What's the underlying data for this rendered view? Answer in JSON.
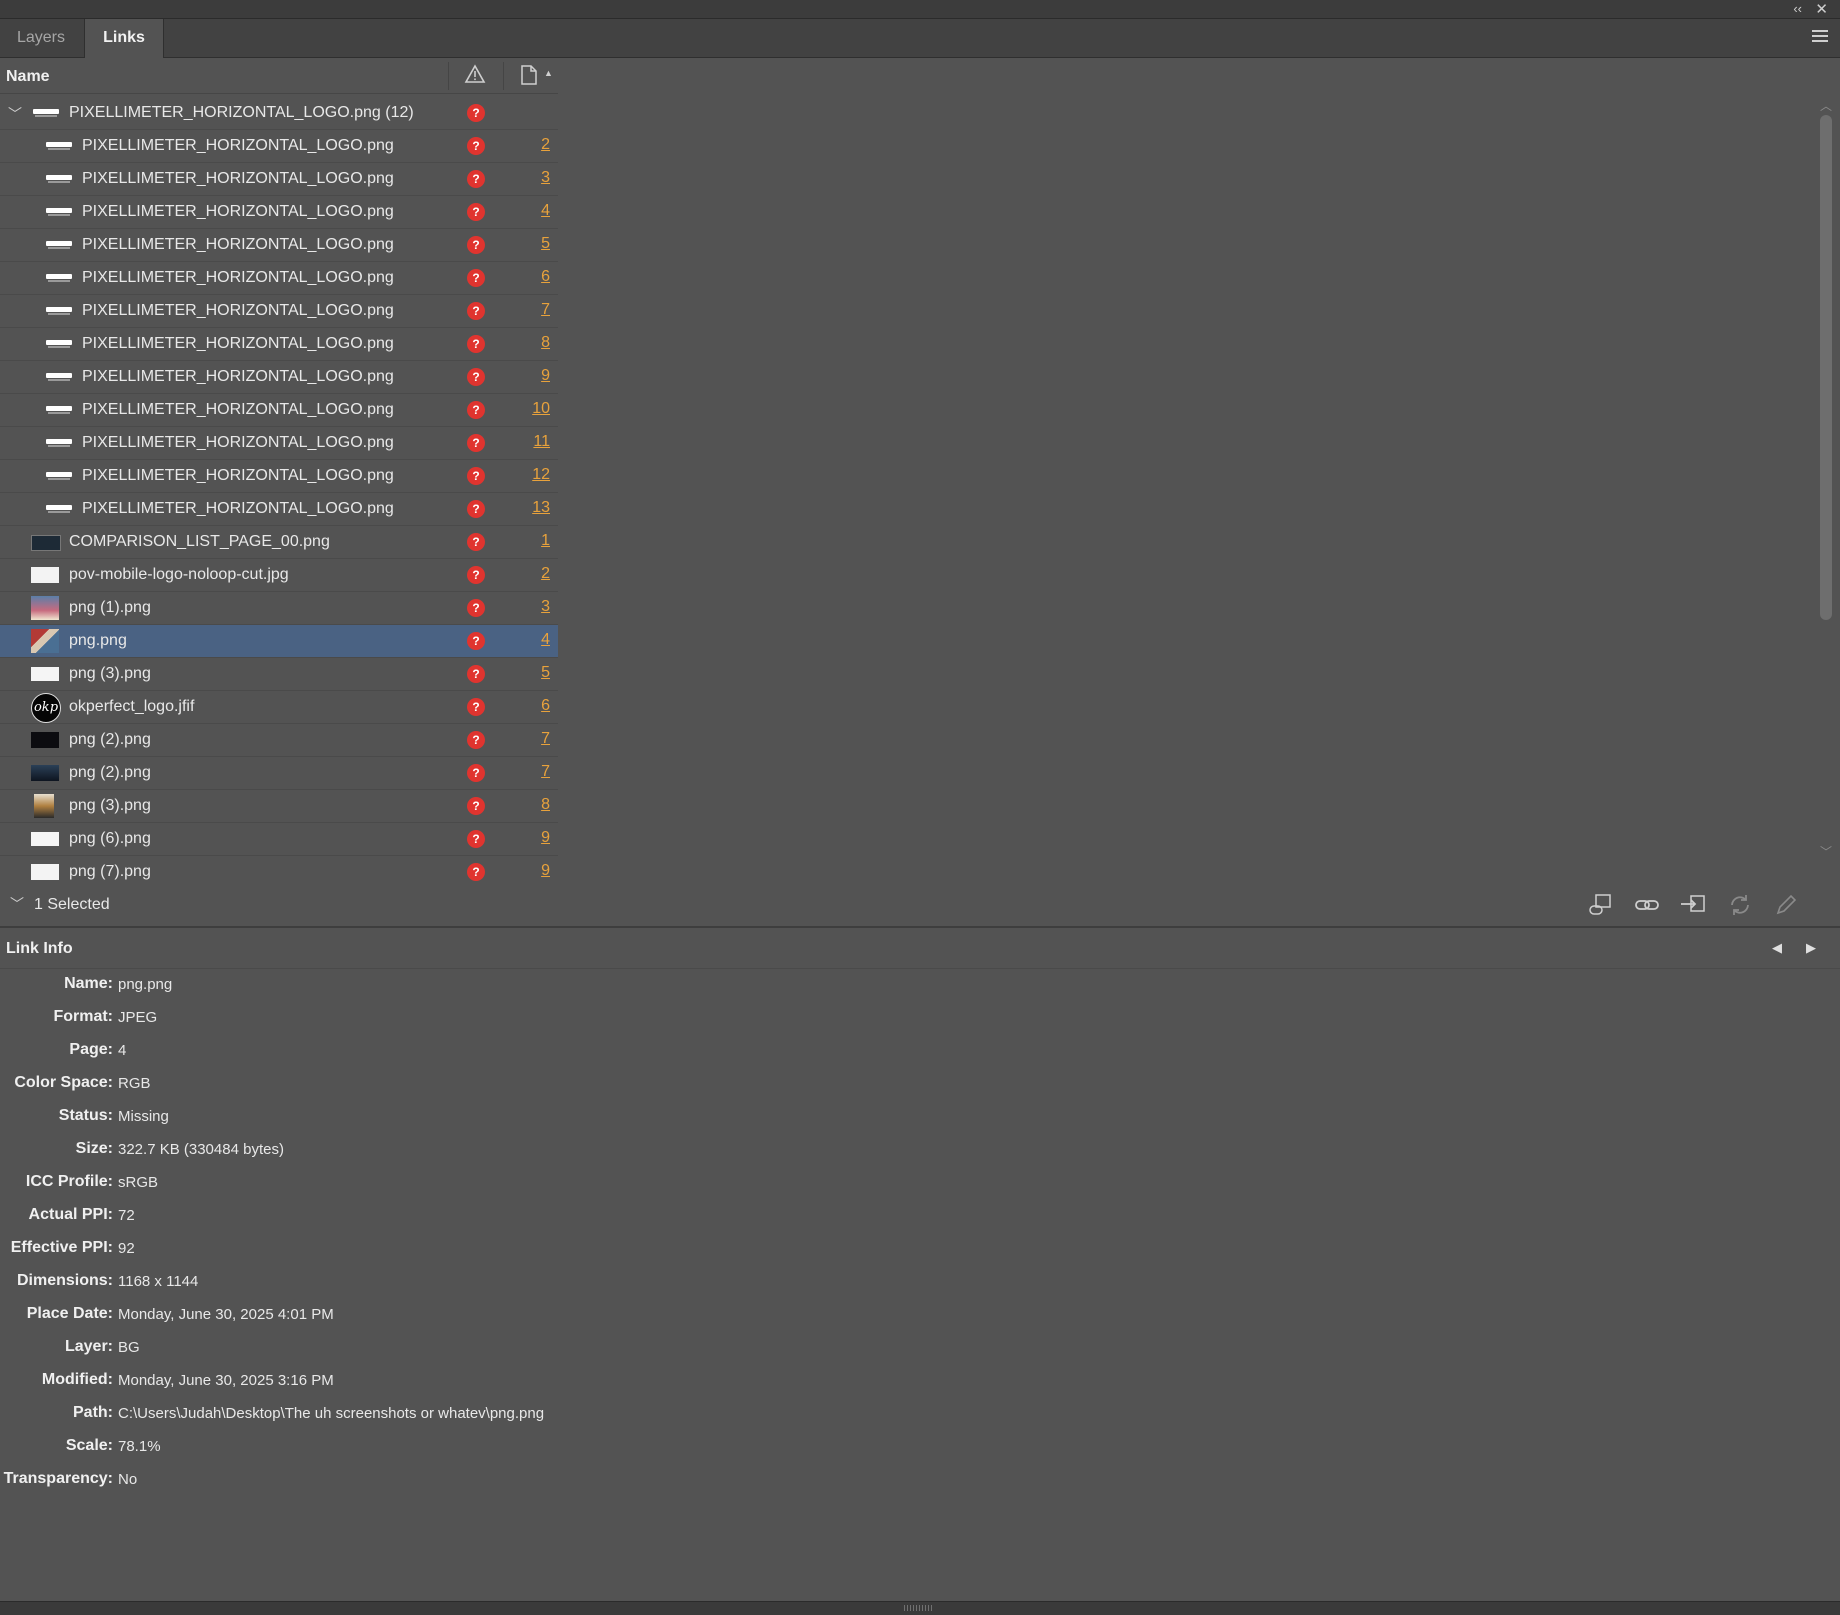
{
  "window": {
    "collapse_glyph": "‹‹",
    "close_glyph": "✕"
  },
  "tabs": [
    {
      "label": "Layers",
      "active": false
    },
    {
      "label": "Links",
      "active": true
    }
  ],
  "columns": {
    "name": "Name",
    "status_icon": "warning-triangle-icon",
    "page_icon": "page-icon"
  },
  "rows": [
    {
      "name": "PIXELLIMETER_HORIZONTAL_LOGO.png (12)",
      "page": "",
      "thumb": "logo",
      "level": 0,
      "twisty": "﹀",
      "selected": false
    },
    {
      "name": "PIXELLIMETER_HORIZONTAL_LOGO.png",
      "page": "2",
      "thumb": "logo",
      "level": 1
    },
    {
      "name": "PIXELLIMETER_HORIZONTAL_LOGO.png",
      "page": "3",
      "thumb": "logo",
      "level": 1
    },
    {
      "name": "PIXELLIMETER_HORIZONTAL_LOGO.png",
      "page": "4",
      "thumb": "logo",
      "level": 1
    },
    {
      "name": "PIXELLIMETER_HORIZONTAL_LOGO.png",
      "page": "5",
      "thumb": "logo",
      "level": 1
    },
    {
      "name": "PIXELLIMETER_HORIZONTAL_LOGO.png",
      "page": "6",
      "thumb": "logo",
      "level": 1
    },
    {
      "name": "PIXELLIMETER_HORIZONTAL_LOGO.png",
      "page": "7",
      "thumb": "logo",
      "level": 1
    },
    {
      "name": "PIXELLIMETER_HORIZONTAL_LOGO.png",
      "page": "8",
      "thumb": "logo",
      "level": 1
    },
    {
      "name": "PIXELLIMETER_HORIZONTAL_LOGO.png",
      "page": "9",
      "thumb": "logo",
      "level": 1
    },
    {
      "name": "PIXELLIMETER_HORIZONTAL_LOGO.png",
      "page": "10",
      "thumb": "logo",
      "level": 1
    },
    {
      "name": "PIXELLIMETER_HORIZONTAL_LOGO.png",
      "page": "11",
      "thumb": "logo",
      "level": 1
    },
    {
      "name": "PIXELLIMETER_HORIZONTAL_LOGO.png",
      "page": "12",
      "thumb": "logo",
      "level": 1
    },
    {
      "name": "PIXELLIMETER_HORIZONTAL_LOGO.png",
      "page": "13",
      "thumb": "logo",
      "level": 1
    },
    {
      "name": "COMPARISON_LIST_PAGE_00.png",
      "page": "1",
      "thumb": "dark-strip",
      "level": 0
    },
    {
      "name": "pov-mobile-logo-noloop-cut.jpg",
      "page": "2",
      "thumb": "white-logo",
      "level": 0
    },
    {
      "name": "png (1).png",
      "page": "3",
      "thumb": "poster",
      "level": 0
    },
    {
      "name": "png.png",
      "page": "4",
      "thumb": "collage",
      "level": 0,
      "selected": true
    },
    {
      "name": "png (3).png",
      "page": "5",
      "thumb": "white",
      "level": 0
    },
    {
      "name": "okperfect_logo.jfif",
      "page": "6",
      "thumb": "okp-circle",
      "level": 0
    },
    {
      "name": "png (2).png",
      "page": "7",
      "thumb": "dark",
      "level": 0
    },
    {
      "name": "png (2).png",
      "page": "7",
      "thumb": "dark-blue",
      "level": 0
    },
    {
      "name": "png (3).png",
      "page": "8",
      "thumb": "poster2",
      "level": 0
    },
    {
      "name": "png (6).png",
      "page": "9",
      "thumb": "white",
      "level": 0
    },
    {
      "name": "png (7).png",
      "page": "9",
      "thumb": "white-logo",
      "level": 0
    }
  ],
  "status_glyph": "?",
  "okp_text": "okp",
  "selection": {
    "twisty": "﹀",
    "count_label": "1 Selected"
  },
  "toolbar_icons": [
    "relink-from-folder-icon",
    "relink-icon",
    "go-to-link-icon",
    "update-link-icon",
    "edit-original-icon"
  ],
  "link_info": {
    "title": "Link Info",
    "prev_glyph": "◀",
    "next_glyph": "▶",
    "fields": [
      {
        "label": "Name:",
        "value": "png.png"
      },
      {
        "label": "Format:",
        "value": "JPEG"
      },
      {
        "label": "Page:",
        "value": "4"
      },
      {
        "label": "Color Space:",
        "value": "RGB"
      },
      {
        "label": "Status:",
        "value": "Missing"
      },
      {
        "label": "Size:",
        "value": "322.7 KB (330484 bytes)"
      },
      {
        "label": "ICC Profile:",
        "value": "sRGB"
      },
      {
        "label": "Actual PPI:",
        "value": "72"
      },
      {
        "label": "Effective PPI:",
        "value": "92"
      },
      {
        "label": "Dimensions:",
        "value": "1168 x 1144"
      },
      {
        "label": "Place Date:",
        "value": "Monday, June 30, 2025 4:01 PM"
      },
      {
        "label": "Layer:",
        "value": "BG"
      },
      {
        "label": "Modified:",
        "value": "Monday, June 30, 2025 3:16 PM"
      },
      {
        "label": "Path:",
        "value": "C:\\Users\\Judah\\Desktop\\The uh screenshots or whatev\\png.png"
      },
      {
        "label": "Scale:",
        "value": "78.1%"
      },
      {
        "label": "Transparency:",
        "value": "No"
      }
    ]
  },
  "colors": {
    "background": "#535353",
    "selected_row": "#4a6283",
    "page_link": "#e8a23c",
    "missing_status": "#e0342f"
  }
}
